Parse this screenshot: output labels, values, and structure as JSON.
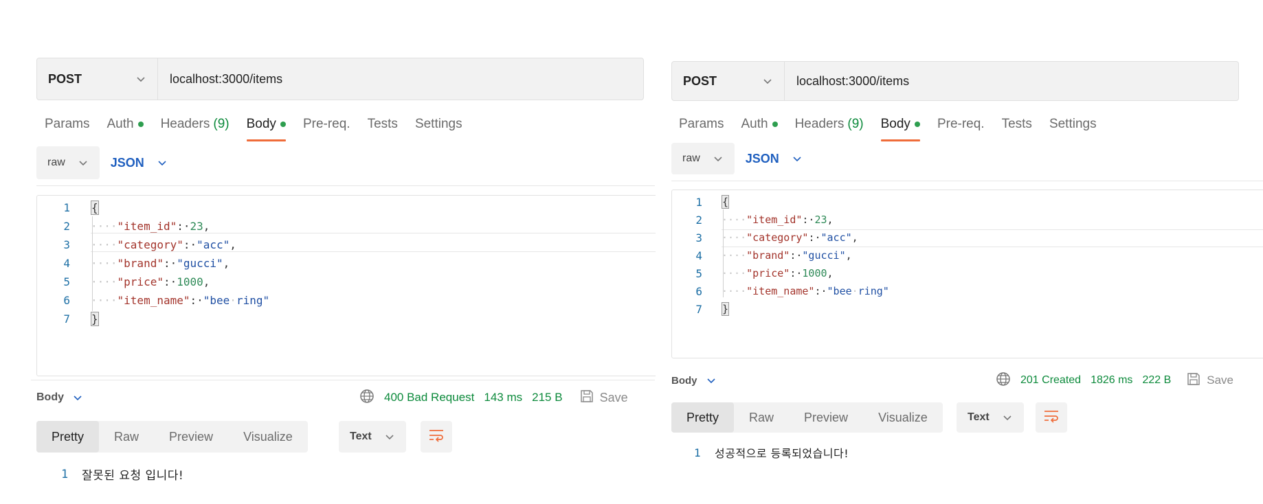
{
  "left": {
    "method": "POST",
    "url": "localhost:3000/items",
    "tabs": {
      "params": "Params",
      "auth": "Auth",
      "headers": "Headers",
      "headers_count": "(9)",
      "body": "Body",
      "prereq": "Pre-req.",
      "tests": "Tests",
      "settings": "Settings"
    },
    "body_type": "raw",
    "format": "JSON",
    "code": {
      "ln1": "1",
      "ln2": "2",
      "ln3": "3",
      "ln4": "4",
      "ln5": "5",
      "ln6": "6",
      "ln7": "7",
      "open": "{",
      "close": "}",
      "k1": "\"item_id\"",
      "v1": "23",
      "k2": "\"category\"",
      "v2": "\"acc\"",
      "k3": "\"brand\"",
      "v3": "\"gucci\"",
      "k4": "\"price\"",
      "v4": "1000",
      "k5": "\"item_name\"",
      "v5": "\"bee ring\""
    },
    "response": {
      "label": "Body",
      "status": "400 Bad Request",
      "time": "143 ms",
      "size": "215 B",
      "save": "Save",
      "view_tabs": {
        "pretty": "Pretty",
        "raw": "Raw",
        "preview": "Preview",
        "visualize": "Visualize"
      },
      "text_select": "Text",
      "line_no": "1",
      "text": "잘못된 요청 입니다!"
    }
  },
  "right": {
    "method": "POST",
    "url": "localhost:3000/items",
    "tabs": {
      "params": "Params",
      "auth": "Auth",
      "headers": "Headers",
      "headers_count": "(9)",
      "body": "Body",
      "prereq": "Pre-req.",
      "tests": "Tests",
      "settings": "Settings"
    },
    "body_type": "raw",
    "format": "JSON",
    "code": {
      "ln1": "1",
      "ln2": "2",
      "ln3": "3",
      "ln4": "4",
      "ln5": "5",
      "ln6": "6",
      "ln7": "7",
      "open": "{",
      "close": "}",
      "k1": "\"item_id\"",
      "v1": "23",
      "k2": "\"category\"",
      "v2": "\"acc\"",
      "k3": "\"brand\"",
      "v3": "\"gucci\"",
      "k4": "\"price\"",
      "v4": "1000",
      "k5": "\"item_name\"",
      "v5": "\"bee ring\""
    },
    "response": {
      "label": "Body",
      "status": "201 Created",
      "time": "1826 ms",
      "size": "222 B",
      "save": "Save",
      "view_tabs": {
        "pretty": "Pretty",
        "raw": "Raw",
        "preview": "Preview",
        "visualize": "Visualize"
      },
      "text_select": "Text",
      "line_no": "1",
      "text": "성공적으로 등록되었습니다!"
    }
  },
  "colors": {
    "accent": "#ef6c3a",
    "success": "#0c8a3b",
    "dot": "#2e9e4f",
    "json_blue": "#1f5fbf"
  },
  "icons": {
    "method_dropdown": "chevron-down-icon",
    "cookie": "globe-icon",
    "save": "save-icon",
    "wrap": "wrap-lines-icon"
  }
}
